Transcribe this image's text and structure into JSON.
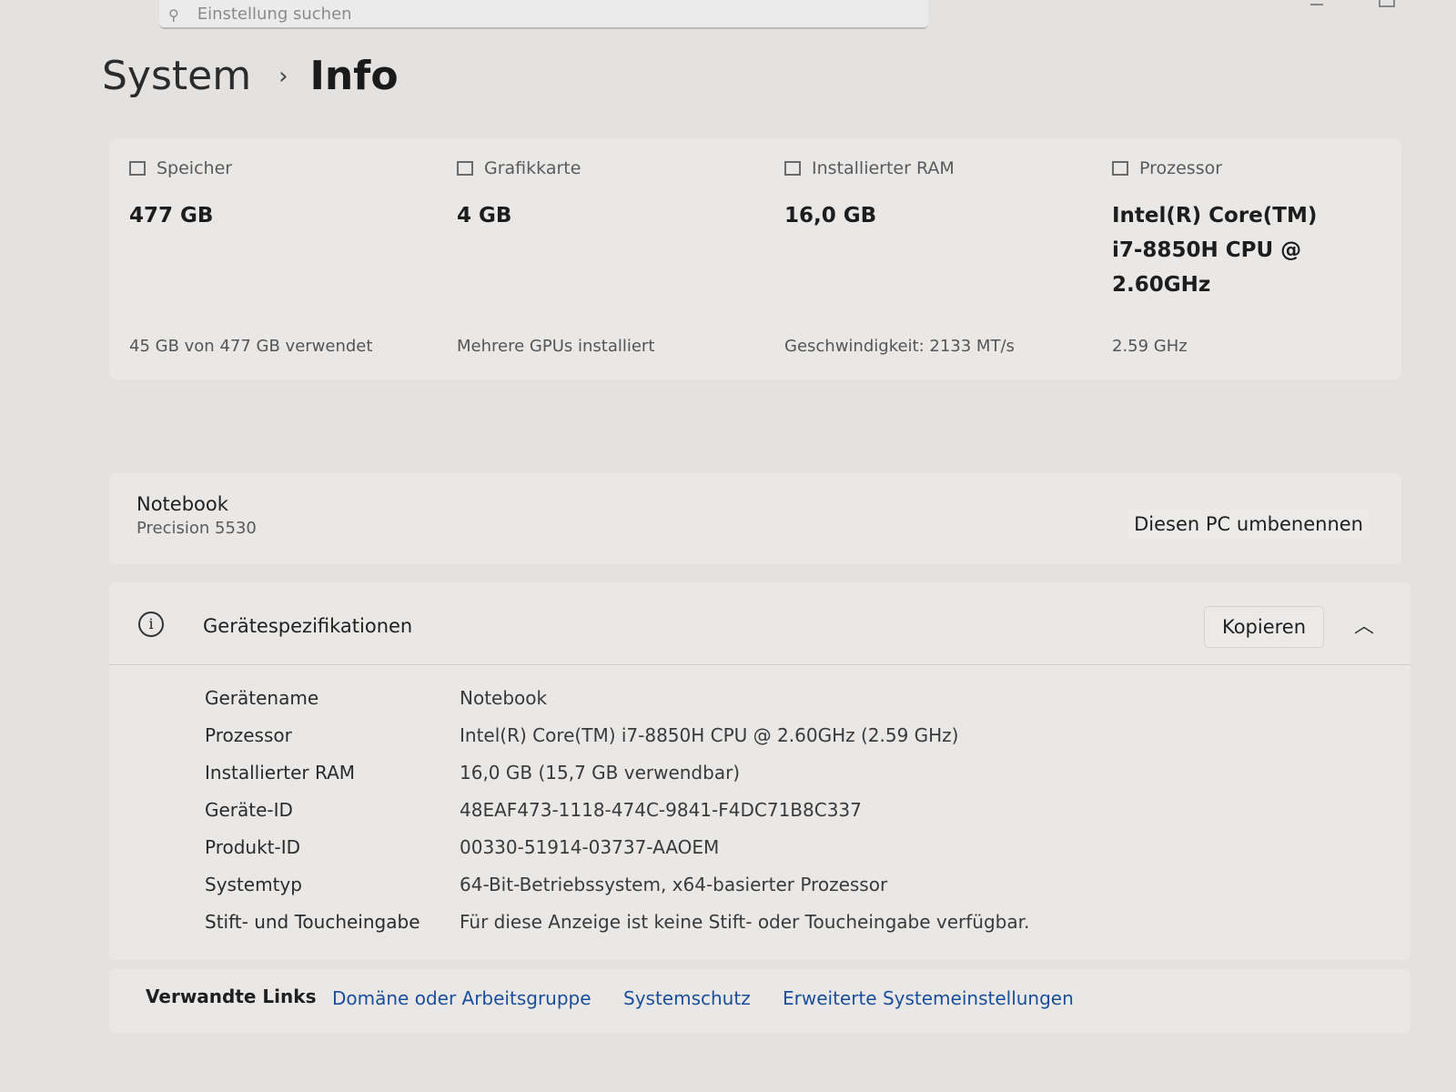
{
  "search": {
    "placeholder": "Einstellung suchen"
  },
  "breadcrumb": {
    "parent": "System",
    "separator": "›",
    "current": "Info"
  },
  "cards": [
    {
      "label": "Speicher",
      "icon": "storage-icon",
      "value": "477 GB",
      "sub": "45 GB von 477 GB verwendet"
    },
    {
      "label": "Grafikkarte",
      "icon": "gpu-icon",
      "value": "4 GB",
      "sub": "Mehrere GPUs installiert"
    },
    {
      "label": "Installierter RAM",
      "icon": "ram-icon",
      "value": "16,0 GB",
      "sub": "Geschwindigkeit: 2133 MT/s"
    },
    {
      "label": "Prozessor",
      "icon": "cpu-icon",
      "value_lines": [
        "Intel(R) Core(TM)",
        "i7-8850H CPU @",
        "2.60GHz"
      ],
      "sub": "2.59 GHz"
    }
  ],
  "device": {
    "name": "Notebook",
    "model": "Precision 5530",
    "rename_label": "Diesen PC umbenennen"
  },
  "specs": {
    "title": "Gerätespezifikationen",
    "copy_label": "Kopieren",
    "rows": [
      {
        "key": "Gerätename",
        "value": "Notebook"
      },
      {
        "key": "Prozessor",
        "value": "Intel(R) Core(TM) i7-8850H CPU @ 2.60GHz (2.59 GHz)"
      },
      {
        "key": "Installierter RAM",
        "value": "16,0 GB (15,7 GB verwendbar)"
      },
      {
        "key": "Geräte-ID",
        "value": "48EAF473-1118-474C-9841-F4DC71B8C337"
      },
      {
        "key": "Produkt-ID",
        "value": "00330-51914-03737-AAOEM"
      },
      {
        "key": "Systemtyp",
        "value": "64-Bit-Betriebssystem, x64-basierter Prozessor"
      },
      {
        "key": "Stift- und Toucheingabe",
        "value": "Für diese Anzeige ist keine Stift- oder Toucheingabe verfügbar."
      }
    ]
  },
  "related_links": {
    "title": "Verwandte Links",
    "links": [
      "Domäne oder Arbeitsgruppe",
      "Systemschutz",
      "Erweiterte Systemeinstellungen"
    ]
  }
}
